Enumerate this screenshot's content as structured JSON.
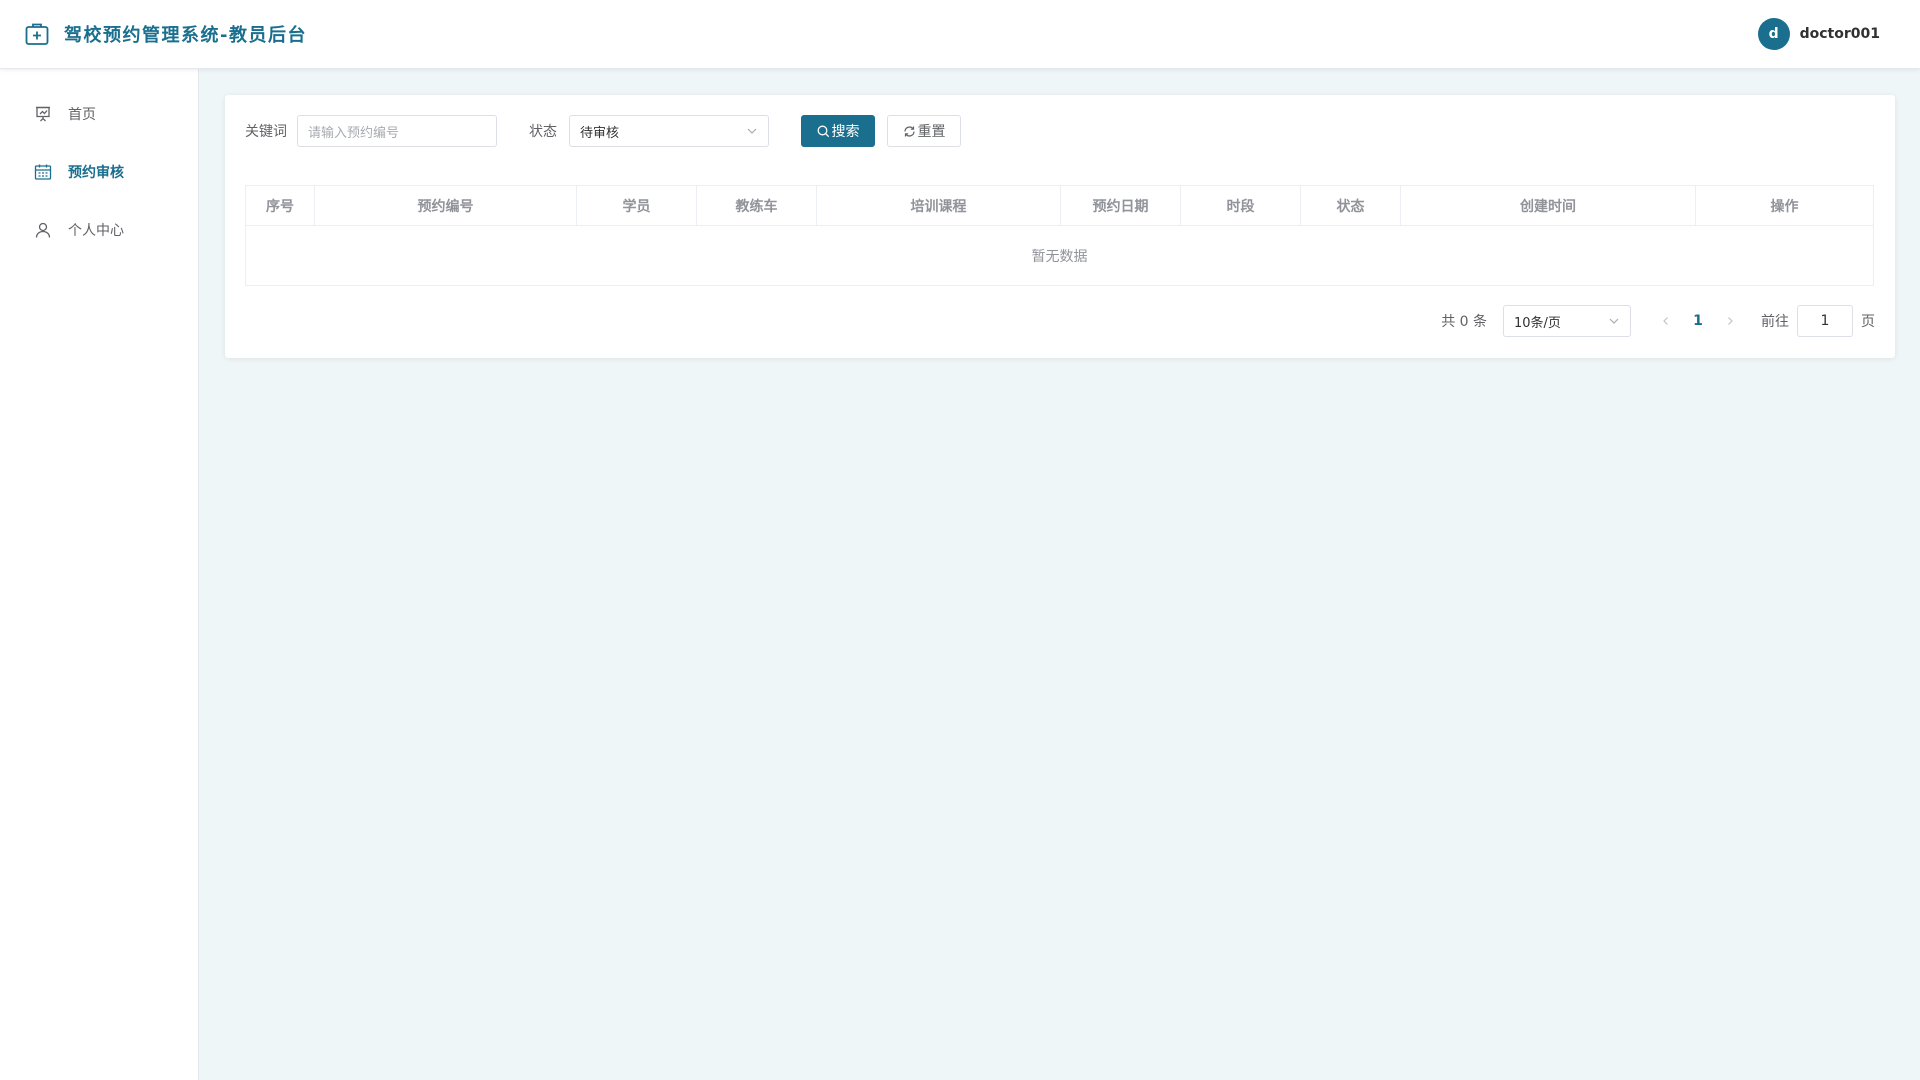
{
  "header": {
    "title": "驾校预约管理系统-教员后台",
    "avatar_letter": "d",
    "username": "doctor001"
  },
  "sidebar": {
    "items": [
      {
        "label": "首页",
        "icon": "presentation-board-icon",
        "active": false
      },
      {
        "label": "预约审核",
        "icon": "calendar-icon",
        "active": true
      },
      {
        "label": "个人中心",
        "icon": "user-icon",
        "active": false
      }
    ]
  },
  "filters": {
    "keyword_label": "关键词",
    "keyword_placeholder": "请输入预约编号",
    "keyword_value": "",
    "status_label": "状态",
    "status_value": "待审核",
    "search_label": "搜索",
    "reset_label": "重置"
  },
  "table": {
    "columns": [
      "序号",
      "预约编号",
      "学员",
      "教练车",
      "培训课程",
      "预约日期",
      "时段",
      "状态",
      "创建时间",
      "操作"
    ],
    "rows": [],
    "empty_text": "暂无数据"
  },
  "pagination": {
    "total_text": "共 0 条",
    "page_size": "10条/页",
    "current_page": "1",
    "goto_label": "前往",
    "goto_value": "1",
    "page_suffix": "页"
  },
  "colors": {
    "primary": "#1a6e8e",
    "background": "#eff6f7"
  }
}
